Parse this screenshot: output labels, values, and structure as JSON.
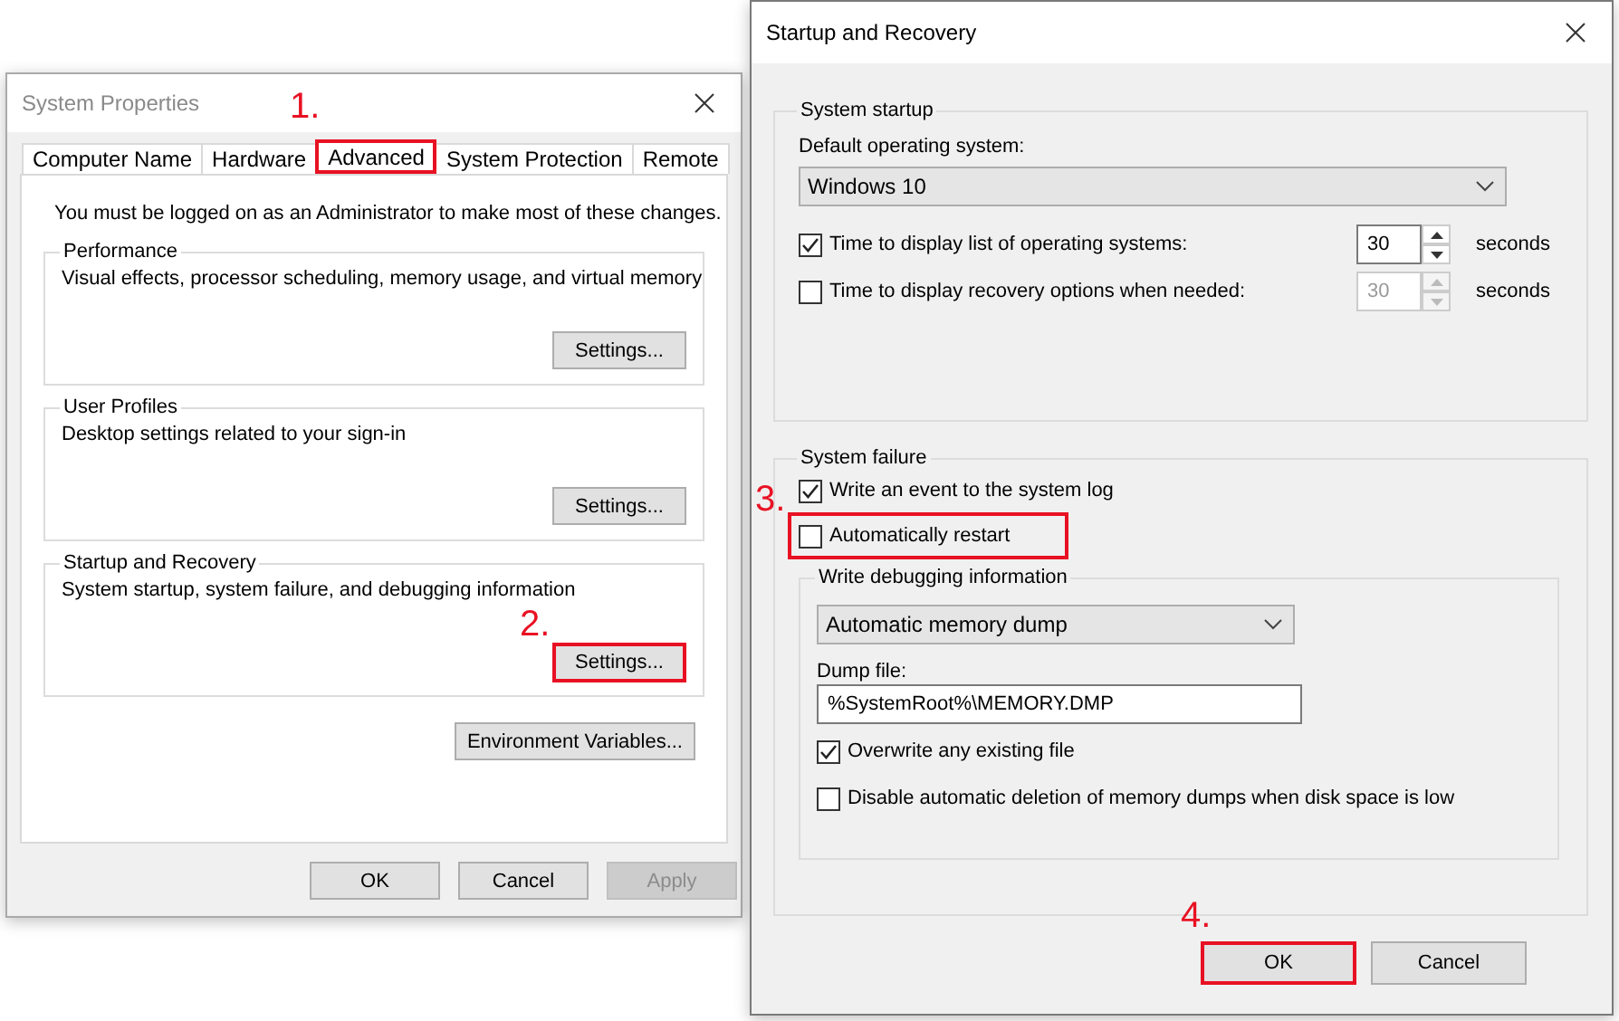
{
  "system_properties": {
    "title": "System Properties",
    "title_step": "1.",
    "tabs": [
      {
        "label": "Computer Name",
        "selected": false,
        "highlighted": false
      },
      {
        "label": "Hardware",
        "selected": false,
        "highlighted": false
      },
      {
        "label": "Advanced",
        "selected": true,
        "highlighted": true
      },
      {
        "label": "System Protection",
        "selected": false,
        "highlighted": false
      },
      {
        "label": "Remote",
        "selected": false,
        "highlighted": false
      }
    ],
    "notice": "You must be logged on as an Administrator to make most of these changes.",
    "groups": [
      {
        "title": "Performance",
        "description": "Visual effects, processor scheduling, memory usage, and virtual memory",
        "button": {
          "label": "Settings...",
          "highlighted": false
        }
      },
      {
        "title": "User Profiles",
        "description": "Desktop settings related to your sign-in",
        "button": {
          "label": "Settings...",
          "highlighted": false
        }
      },
      {
        "title": "Startup and Recovery",
        "description": "System startup, system failure, and debugging information",
        "button": {
          "label": "Settings...",
          "highlighted": true,
          "step": "2."
        }
      }
    ],
    "environment_button": "Environment Variables...",
    "buttons": [
      {
        "label": "OK",
        "disabled": false
      },
      {
        "label": "Cancel",
        "disabled": false
      },
      {
        "label": "Apply",
        "disabled": true
      }
    ]
  },
  "startup_and_recovery": {
    "title": "Startup and Recovery",
    "system_startup": {
      "title": "System startup",
      "default_os_label": "Default operating system:",
      "default_os": "Windows 10",
      "options": [
        {
          "label": "Time to display list of operating systems:",
          "checked": true,
          "value": "30",
          "spin_disabled": false,
          "unit": "seconds"
        },
        {
          "label": "Time to display recovery options when needed:",
          "checked": false,
          "value": "30",
          "spin_disabled": true,
          "unit": "seconds"
        }
      ]
    },
    "system_failure": {
      "title": "System failure",
      "options": [
        {
          "label": "Write an event to the system log",
          "checked": true,
          "highlighted": false
        },
        {
          "label": "Automatically restart",
          "checked": false,
          "highlighted": true,
          "step": "3."
        }
      ],
      "debugging": {
        "title": "Write debugging information",
        "dump_type": "Automatic memory dump",
        "dump_file_label": "Dump file:",
        "dump_file": "%SystemRoot%\\MEMORY.DMP",
        "options": [
          {
            "label": "Overwrite any existing file",
            "checked": true
          },
          {
            "label": "Disable automatic deletion of memory dumps when disk space is low",
            "checked": false
          }
        ]
      }
    },
    "buttons": [
      {
        "label": "OK",
        "highlighted": true,
        "step": "4."
      },
      {
        "label": "Cancel",
        "highlighted": false
      }
    ]
  }
}
